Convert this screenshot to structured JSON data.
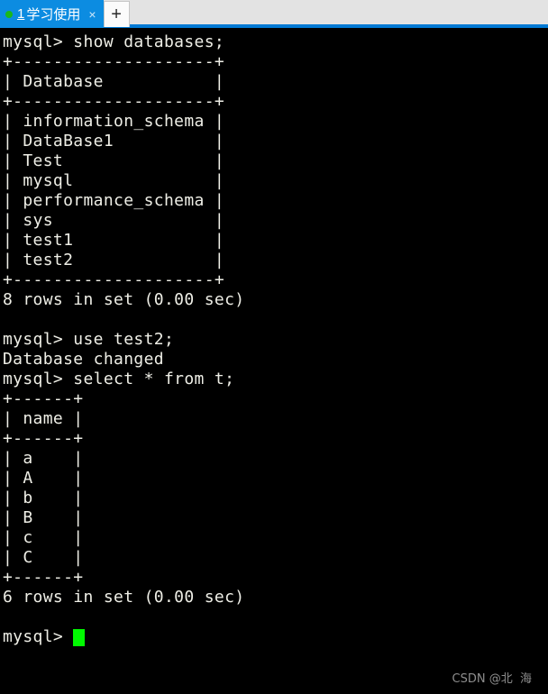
{
  "tabbar": {
    "active_tab": {
      "status_dot": "green-status-dot",
      "index": "1",
      "title": "学习使用",
      "close_label": "×"
    },
    "new_tab_label": "+",
    "colors": {
      "tab_active_bg": "#0c8ce1",
      "bar_bg": "#e3e3e3",
      "accent_line": "#0079d4",
      "dot": "#1ab81a"
    }
  },
  "terminal": {
    "colors": {
      "background": "#000000",
      "foreground": "#eeeee6",
      "cursor": "#00f900"
    },
    "lines": [
      "mysql> show databases;",
      "+--------------------+",
      "| Database           |",
      "+--------------------+",
      "| information_schema |",
      "| DataBase1          |",
      "| Test               |",
      "| mysql              |",
      "| performance_schema |",
      "| sys                |",
      "| test1              |",
      "| test2              |",
      "+--------------------+",
      "8 rows in set (0.00 sec)",
      "",
      "mysql> use test2;",
      "Database changed",
      "mysql> select * from t;",
      "+------+",
      "| name |",
      "+------+",
      "| a    |",
      "| A    |",
      "| b    |",
      "| B    |",
      "| c    |",
      "| C    |",
      "+------+",
      "6 rows in set (0.00 sec)",
      ""
    ],
    "prompt": "mysql> ",
    "cursor_glyph": "block-cursor"
  },
  "watermark": {
    "text": "CSDN @北  海"
  }
}
